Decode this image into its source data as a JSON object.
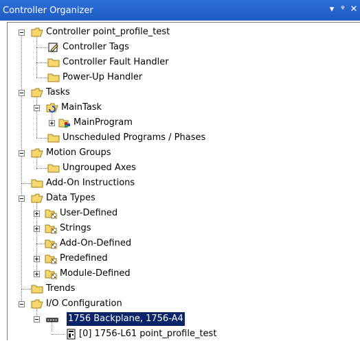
{
  "window": {
    "title": "Controller Organizer",
    "buttons": [
      "▾",
      "ᵠ",
      "✕"
    ]
  },
  "tree": {
    "controller": "Controller point_profile_test",
    "controller_tags": "Controller Tags",
    "controller_fault_handler": "Controller Fault Handler",
    "power_up_handler": "Power-Up Handler",
    "tasks": "Tasks",
    "main_task": "MainTask",
    "main_program": "MainProgram",
    "unscheduled": "Unscheduled Programs / Phases",
    "motion_groups": "Motion Groups",
    "ungrouped_axes": "Ungrouped Axes",
    "add_on_instructions": "Add-On Instructions",
    "data_types": "Data Types",
    "user_defined": "User-Defined",
    "strings": "Strings",
    "add_on_defined": "Add-On-Defined",
    "predefined": "Predefined",
    "module_defined": "Module-Defined",
    "trends": "Trends",
    "io_configuration": "I/O Configuration",
    "backplane": "1756 Backplane, 1756-A4",
    "controller_module": "[0] 1756-L61 point_profile_test"
  },
  "colors": {
    "titlebar": "#1d5bc4",
    "folder": "#f5d76e",
    "selection": "#0a246a"
  }
}
